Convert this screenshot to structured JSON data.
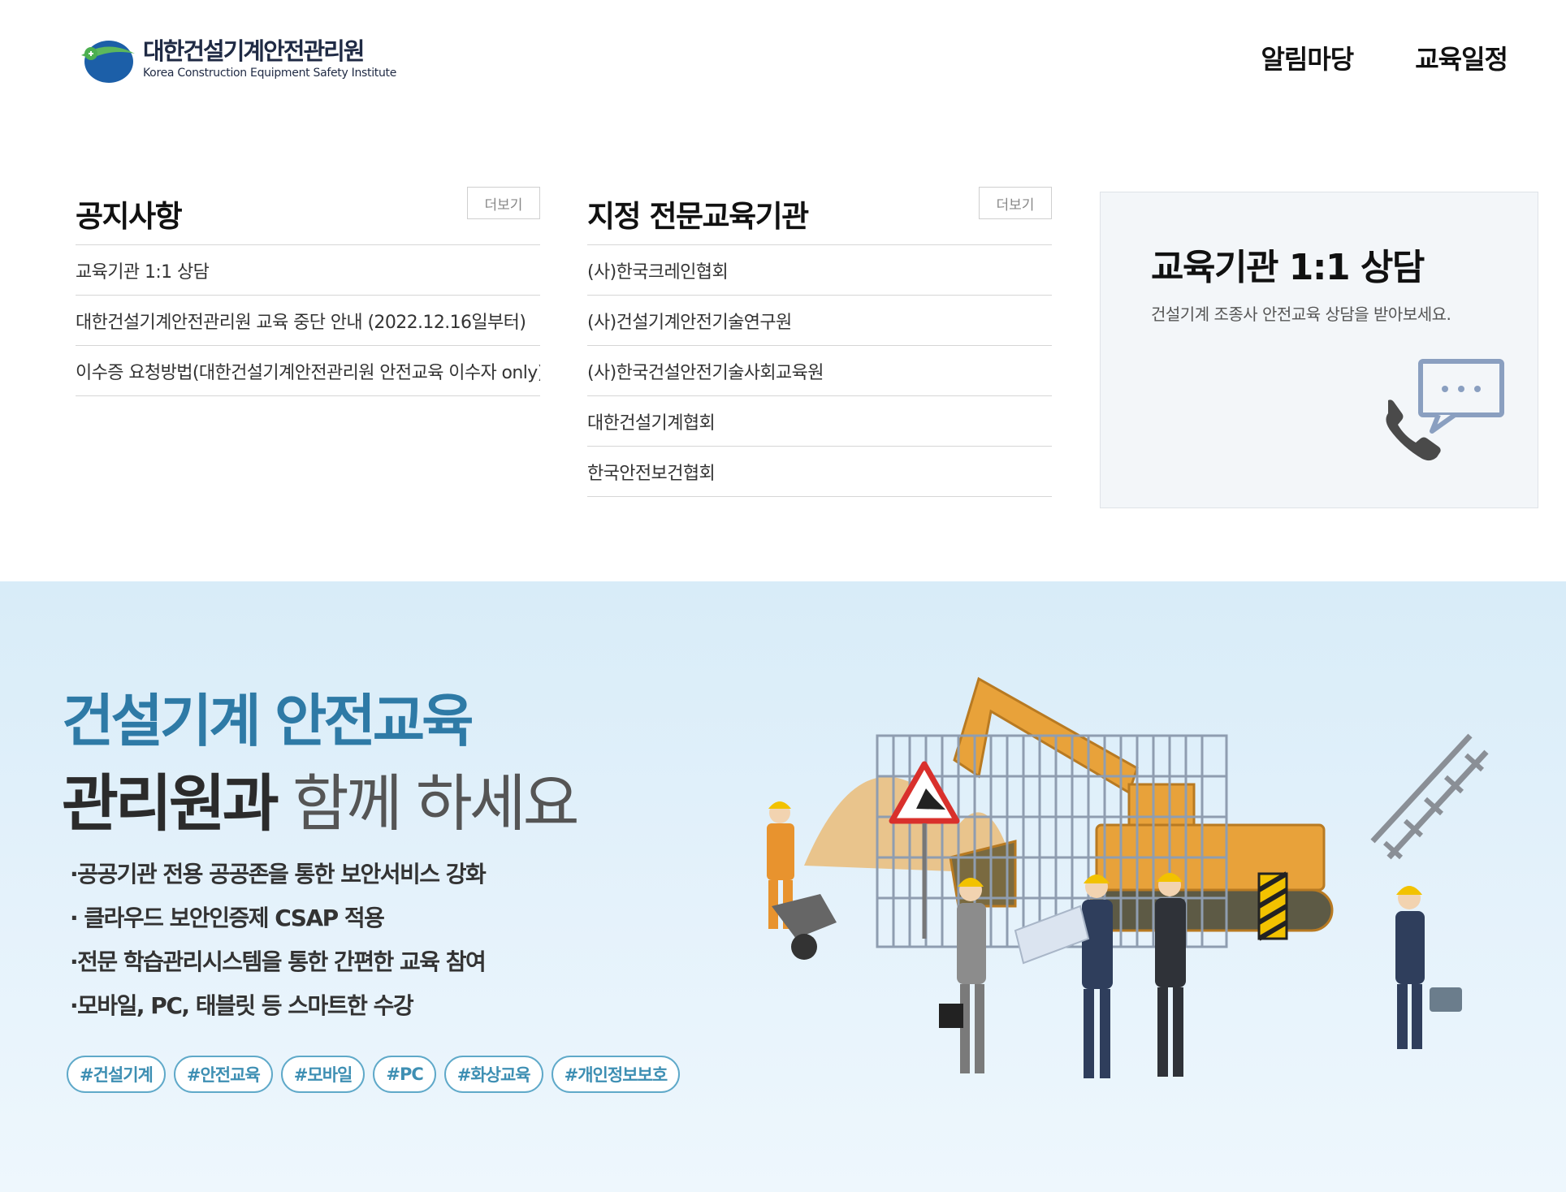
{
  "header": {
    "logo_ko": "대한건설기계안전관리원",
    "logo_en": "Korea Construction Equipment Safety Institute",
    "nav": [
      {
        "label": "알림마당"
      },
      {
        "label": "교육일정"
      }
    ]
  },
  "notice": {
    "title": "공지사항",
    "more_label": "더보기",
    "items": [
      {
        "text": "교육기관 1:1 상담"
      },
      {
        "text": "대한건설기계안전관리원 교육 중단 안내 (2022.12.16일부터)"
      },
      {
        "text": "이수증 요청방법(대한건설기계안전관리원 안전교육 이수자 only)"
      }
    ]
  },
  "institutions": {
    "title": "지정 전문교육기관",
    "more_label": "더보기",
    "items": [
      {
        "text": "(사)한국크레인협회"
      },
      {
        "text": "(사)건설기계안전기술연구원"
      },
      {
        "text": "(사)한국건설안전기술사회교육원"
      },
      {
        "text": "대한건설기계협회"
      },
      {
        "text": "한국안전보건협회"
      }
    ]
  },
  "counsel": {
    "title": "교육기관 1:1 상담",
    "desc": "건설기계 조종사 안전교육 상담을 받아보세요.",
    "icon": "phone-chat-icon"
  },
  "hero": {
    "line1": "건설기계 안전교육",
    "line2_strong": "관리원과",
    "line2_light": " 함께 하세요",
    "bullets": [
      "·공공기관 전용 공공존을 통한 보안서비스 강화",
      "· 클라우드 보안인증제 CSAP 적용",
      "·전문 학습관리시스템을 통한 간편한 교육 참여",
      "·모바일, PC, 태블릿 등 스마트한 수강"
    ],
    "tags": [
      "#건설기계",
      "#안전교육",
      "#모바일",
      "#PC",
      "#화상교육",
      "#개인정보보호"
    ]
  },
  "colors": {
    "accent_blue": "#2e7aa6",
    "tag_border": "#5fa9c9",
    "hero_bg": "#d8ecf8",
    "excavator": "#e8a23a"
  }
}
